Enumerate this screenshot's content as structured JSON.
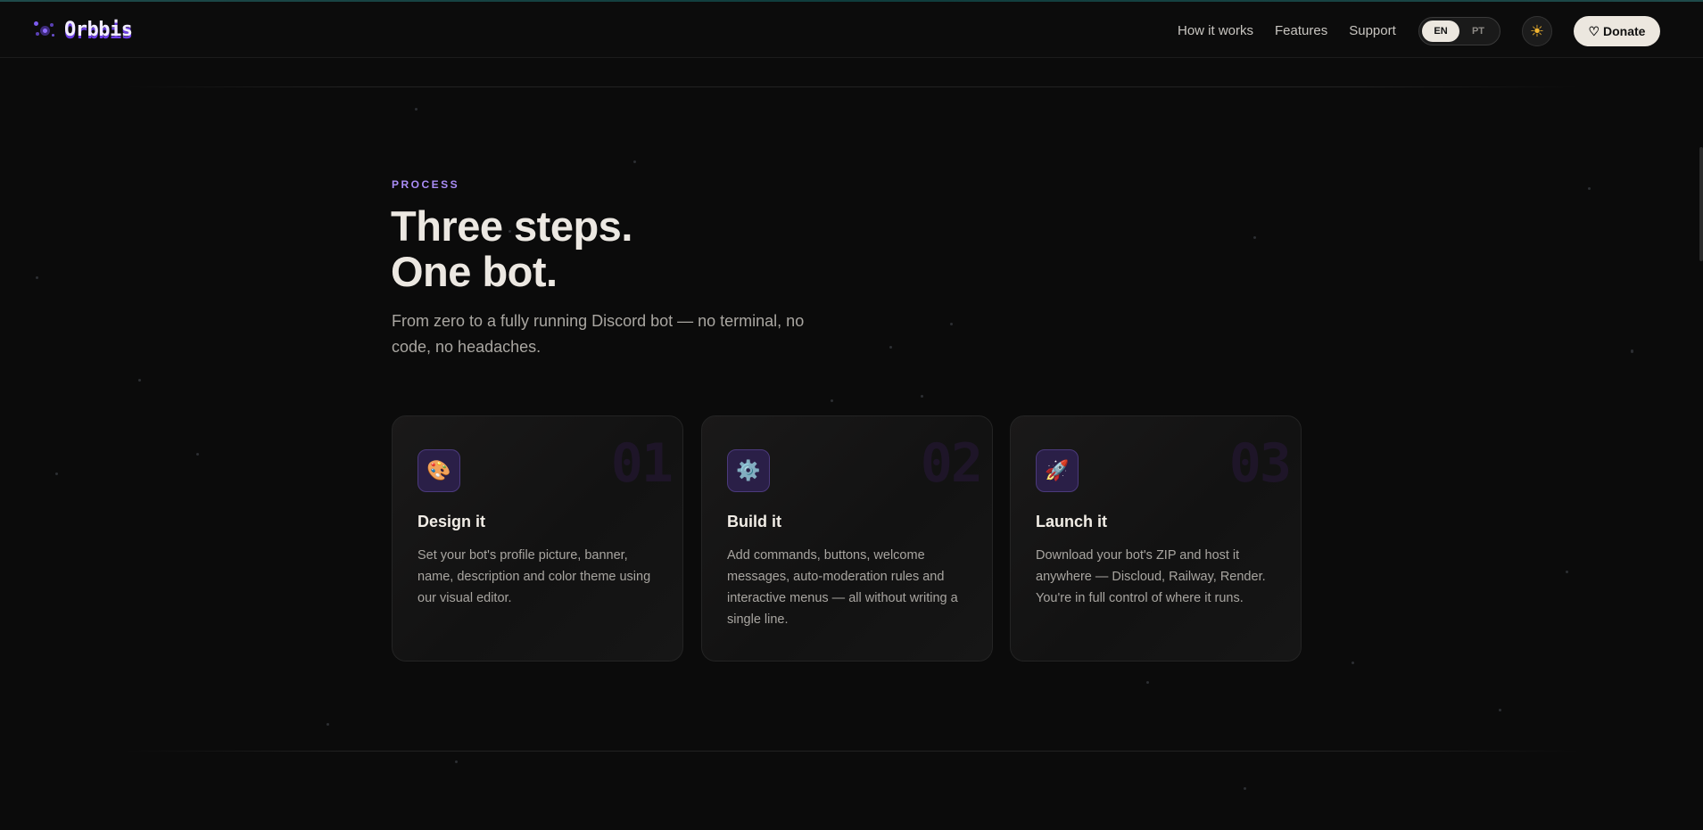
{
  "header": {
    "logo_text": "Orbbis",
    "nav": [
      "How it works",
      "Features",
      "Support"
    ],
    "lang_options": [
      "EN",
      "PT"
    ],
    "lang_selected": "EN",
    "theme_icon": "☀",
    "donate_label": "♡ Donate"
  },
  "section": {
    "eyebrow": "PROCESS",
    "heading_line1": "Three steps.",
    "heading_line2": "One bot.",
    "subtext": "From zero to a fully running Discord bot — no terminal, no code, no headaches."
  },
  "cards": [
    {
      "number": "01",
      "icon": "🎨",
      "icon_name": "palette-icon",
      "title": "Design it",
      "description": "Set your bot's profile picture, banner, name, description and color theme using our visual editor."
    },
    {
      "number": "02",
      "icon": "⚙️",
      "icon_name": "gear-icon",
      "title": "Build it",
      "description": "Add commands, buttons, welcome messages, auto-moderation rules and interactive menus — all without writing a single line."
    },
    {
      "number": "03",
      "icon": "🚀",
      "icon_name": "rocket-icon",
      "title": "Launch it",
      "description": "Download your bot's ZIP and host it anywhere — Discloud, Railway, Render. You're in full control of where it runs."
    }
  ],
  "colors": {
    "background": "#0b0b0b",
    "accent": "#a98cf5",
    "icon_tile": "#2a1f47",
    "button": "#ece7df"
  }
}
